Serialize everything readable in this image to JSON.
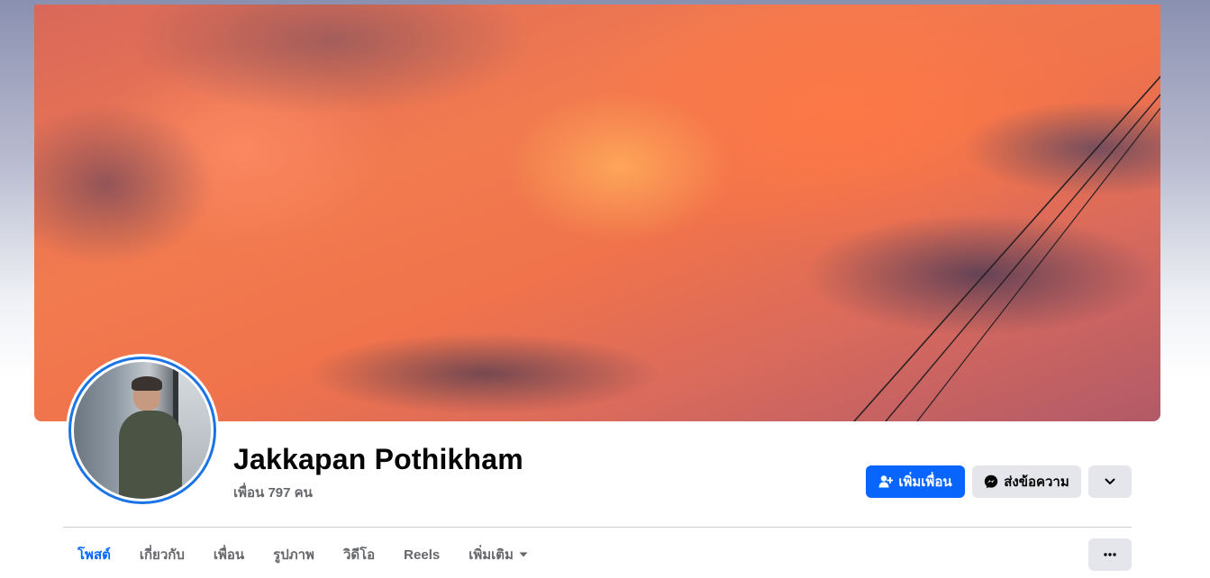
{
  "profile": {
    "name": "Jakkapan Pothikham",
    "friends_text": "เพื่อน 797 คน"
  },
  "actions": {
    "add_friend_label": "เพิ่มเพื่อน",
    "message_label": "ส่งข้อความ",
    "more_icon": "chevron-down-icon"
  },
  "tabs": [
    {
      "label": "โพสต์",
      "active": true
    },
    {
      "label": "เกี่ยวกับ",
      "active": false
    },
    {
      "label": "เพื่อน",
      "active": false
    },
    {
      "label": "รูปภาพ",
      "active": false
    },
    {
      "label": "วิดีโอ",
      "active": false
    },
    {
      "label": "Reels",
      "active": false
    },
    {
      "label": "เพิ่มเติม",
      "active": false
    }
  ],
  "tabs_more_icon": "ellipsis-icon",
  "colors": {
    "accent": "#0866ff",
    "button_gray": "#e4e6eb",
    "text_secondary": "#65676b"
  }
}
